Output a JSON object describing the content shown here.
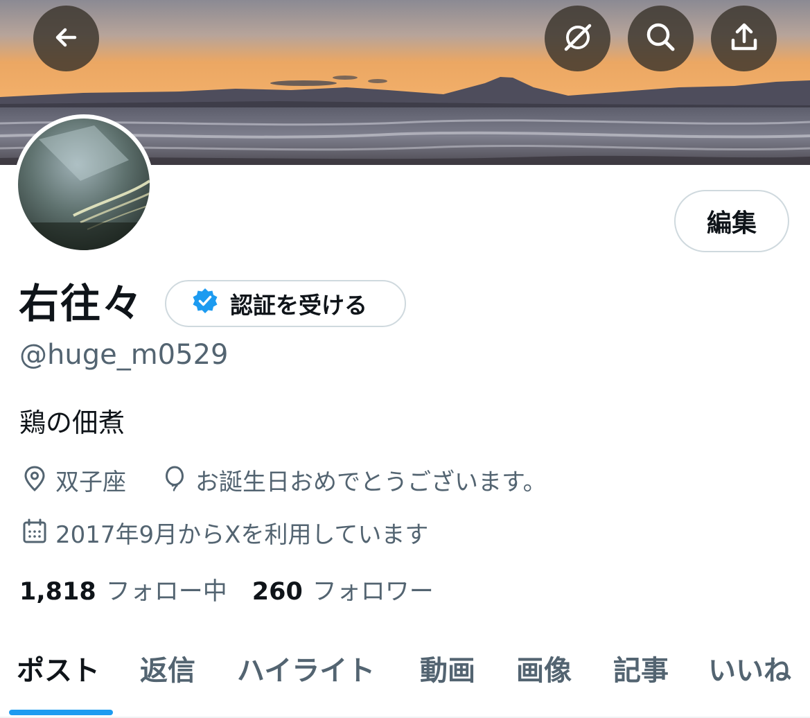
{
  "header": {
    "back_icon": "arrow-left-icon",
    "actions": [
      "grok-icon",
      "search-icon",
      "share-icon"
    ]
  },
  "profile": {
    "display_name": "右往々",
    "verify_label": "認証を受ける",
    "handle": "@huge_m0529",
    "bio": "鶏の佃煮",
    "location": "双子座",
    "birthday": "お誕生日おめでとうございます。",
    "joined": "2017年9月からXを利用しています",
    "edit_label": "編集"
  },
  "stats": {
    "following_count": "1,818",
    "following_label": "フォロー中",
    "followers_count": "260",
    "followers_label": "フォロワー"
  },
  "tabs": [
    {
      "label": "ポスト"
    },
    {
      "label": "返信"
    },
    {
      "label": "ハイライト"
    },
    {
      "label": "動画"
    },
    {
      "label": "画像"
    },
    {
      "label": "記事"
    },
    {
      "label": "いいね"
    }
  ],
  "colors": {
    "accent": "#1d9bf0",
    "secondary_text": "#536471",
    "primary_text": "#0f1419",
    "border": "#cfd9de"
  }
}
